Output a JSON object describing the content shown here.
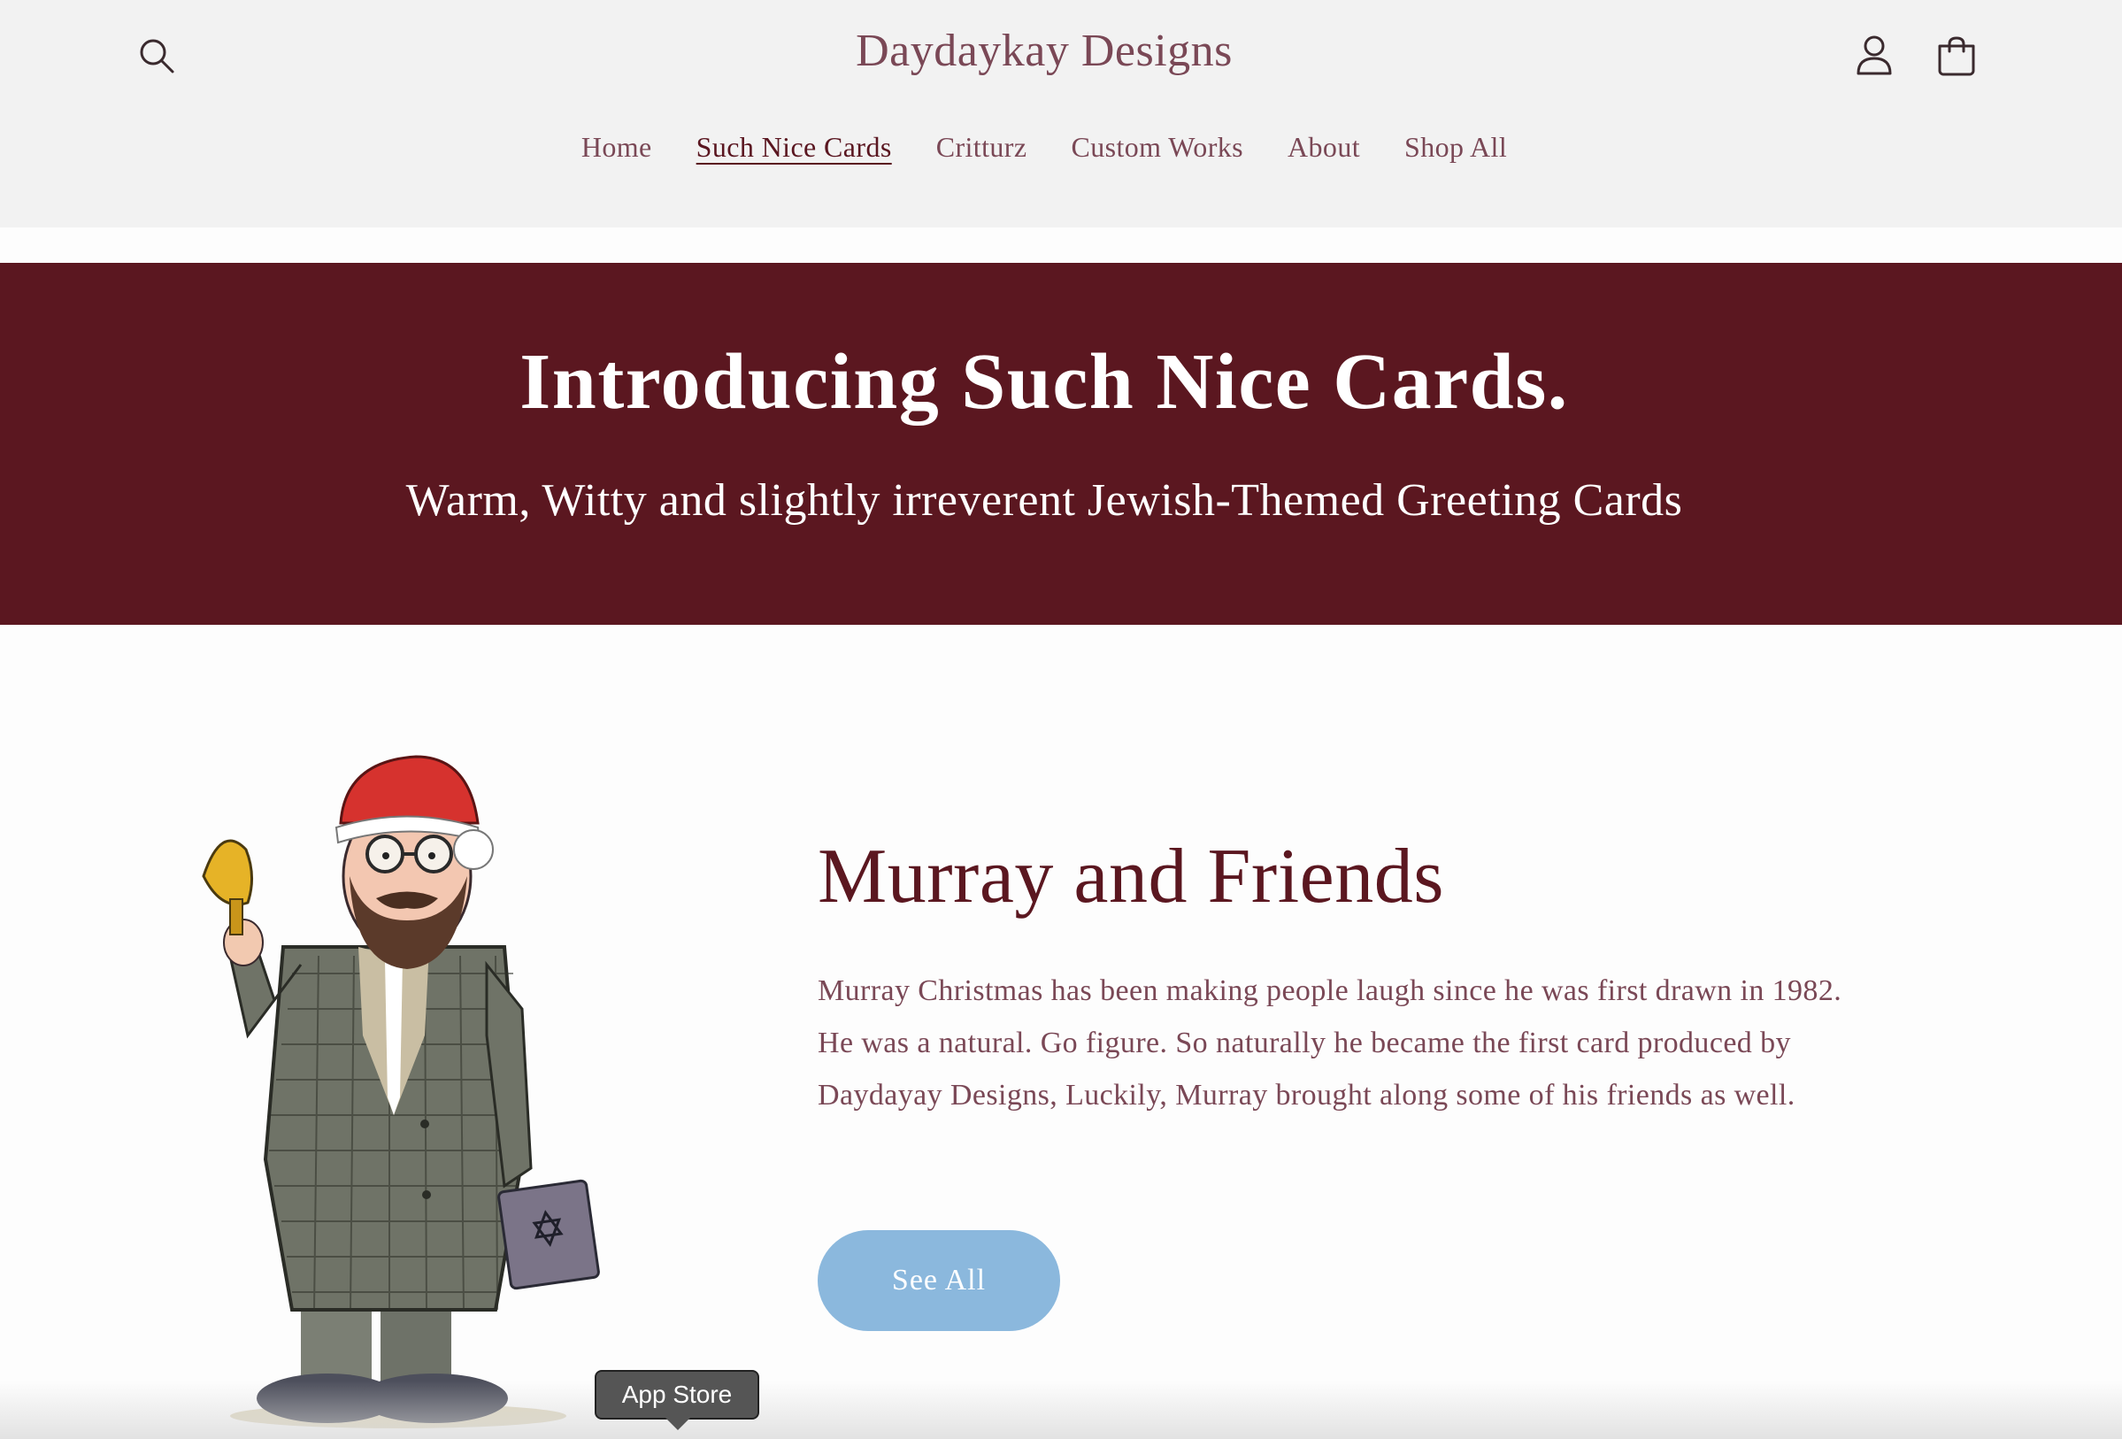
{
  "header": {
    "site_title": "Daydaykay Designs",
    "search_icon": "search-icon",
    "account_icon": "user-icon",
    "cart_icon": "cart-icon"
  },
  "nav": {
    "items": [
      {
        "label": "Home",
        "active": false
      },
      {
        "label": "Such Nice Cards",
        "active": true
      },
      {
        "label": "Critturz",
        "active": false
      },
      {
        "label": "Custom Works",
        "active": false
      },
      {
        "label": "About",
        "active": false
      },
      {
        "label": "Shop All",
        "active": false
      }
    ]
  },
  "banner": {
    "title": "Introducing Such Nice Cards.",
    "subtitle": "Warm, Witty and slightly irreverent Jewish-Themed Greeting Cards"
  },
  "feature": {
    "title": "Murray and Friends",
    "body": "Murray Christmas has been making people laugh since he was first drawn in 1982. He was a natural. Go figure. So naturally he became the first card produced by Daydayay Designs, Luckily, Murray brought along some of his friends as well.",
    "button_label": "See All"
  },
  "tooltip": {
    "label": "App Store"
  },
  "colors": {
    "header_bg": "#f2f2f2",
    "banner_bg": "#5b1720",
    "brand_text": "#7a4856",
    "heading": "#5b1720",
    "button": "#8bb8dd"
  }
}
